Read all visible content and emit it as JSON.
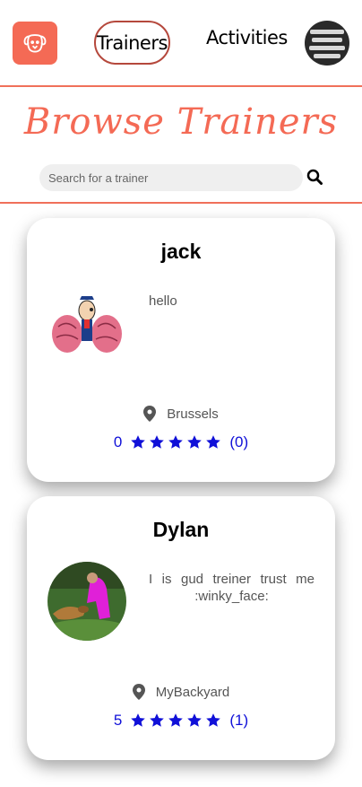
{
  "nav": {
    "logo_icon": "dog-face-icon",
    "trainers_label": "Trainers",
    "activities_label": "Activities",
    "avatar_icon": "user-avatar"
  },
  "hero": {
    "title": "Browse Trainers",
    "search_placeholder": "Search for a trainer",
    "search_icon": "search-icon"
  },
  "colors": {
    "accent": "#f46a55",
    "rating": "#1010d8"
  },
  "trainers": [
    {
      "name": "jack",
      "bio": "hello",
      "location": "Brussels",
      "rating": "0",
      "stars": 5,
      "review_count": "(0)"
    },
    {
      "name": "Dylan",
      "bio": "I is gud treiner trust me :winky_face:",
      "location": "MyBackyard",
      "rating": "5",
      "stars": 5,
      "review_count": "(1)"
    }
  ]
}
